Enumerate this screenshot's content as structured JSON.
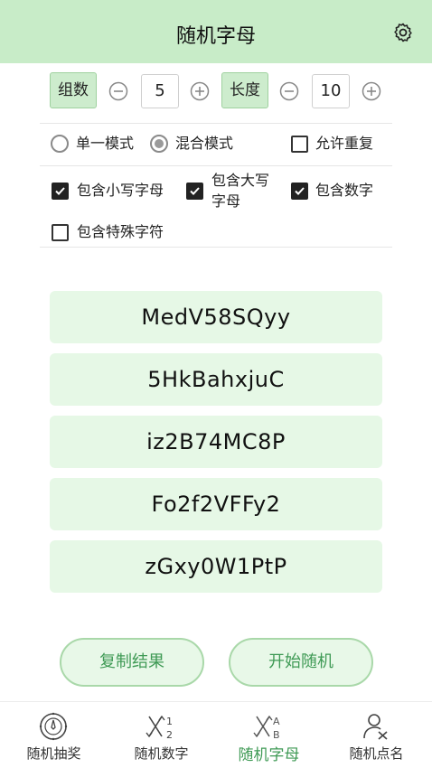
{
  "header": {
    "title": "随机字母",
    "settings_icon": "gear-icon"
  },
  "groups": {
    "label": "组数",
    "value": "5",
    "minus_icon": "minus-circle-icon",
    "plus_icon": "plus-circle-icon"
  },
  "length": {
    "label": "长度",
    "value": "10",
    "minus_icon": "minus-circle-icon",
    "plus_icon": "plus-circle-icon"
  },
  "mode": {
    "single_label": "单一模式",
    "mixed_label": "混合模式",
    "selected": "mixed"
  },
  "options": {
    "allow_repeat": {
      "label": "允许重复",
      "checked": false
    },
    "lowercase": {
      "label": "包含小写字母",
      "checked": true
    },
    "uppercase": {
      "label_line1": "包含大写",
      "label_line2": "字母",
      "checked": true
    },
    "digits": {
      "label": "包含数字",
      "checked": true
    },
    "special": {
      "label": "包含特殊字符",
      "checked": false
    }
  },
  "results": [
    "MedV58SQyy",
    "5HkBahxjuC",
    "iz2B74MC8P",
    "Fo2f2VFFy2",
    "zGxy0W1PtP"
  ],
  "actions": {
    "copy_label": "复制结果",
    "start_label": "开始随机"
  },
  "nav": {
    "items": [
      {
        "label": "随机抽奖",
        "icon": "wheel-icon"
      },
      {
        "label": "随机数字",
        "icon": "shuffle-numbers-icon"
      },
      {
        "label": "随机字母",
        "icon": "shuffle-letters-icon",
        "active": true
      },
      {
        "label": "随机点名",
        "icon": "person-pick-icon"
      }
    ]
  },
  "colors": {
    "header_bg": "#c8ecc8",
    "accent": "#3f9a55",
    "result_bg": "#e6f8e6"
  }
}
